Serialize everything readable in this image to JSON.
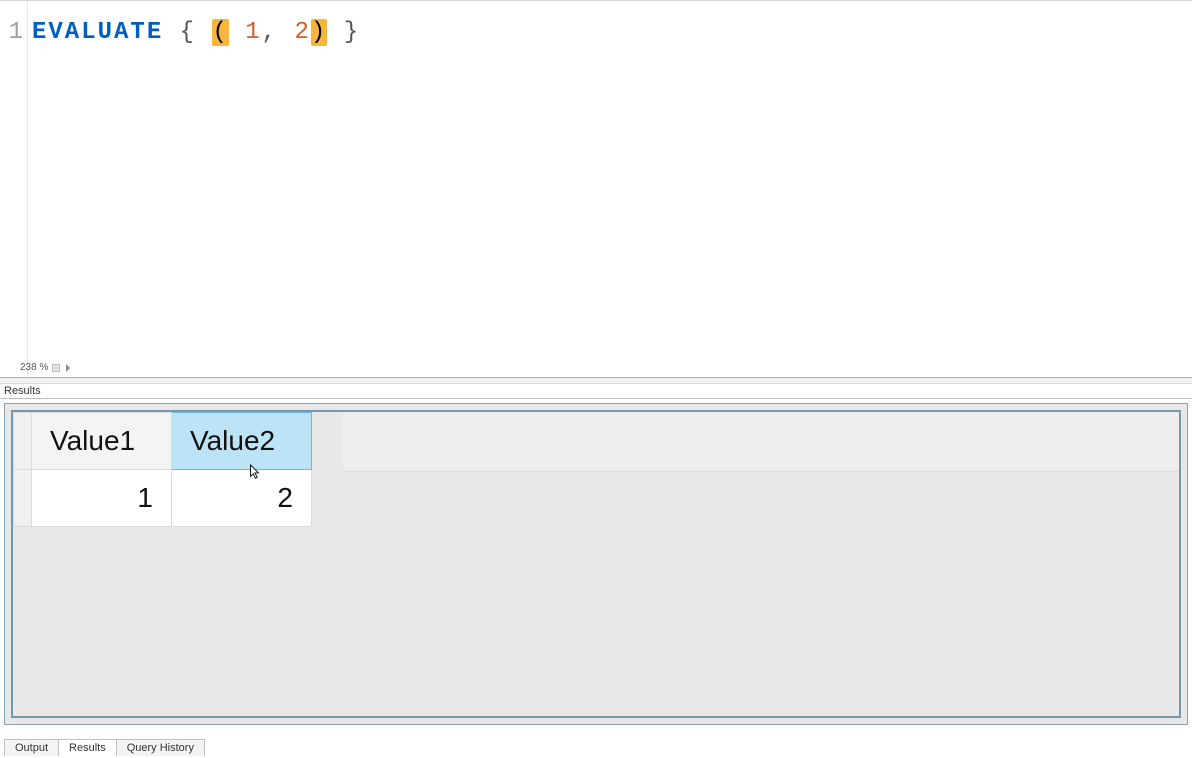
{
  "editor": {
    "line_number": "1",
    "tokens": {
      "keyword": "EVALUATE",
      "open_brace": "{",
      "open_paren": "(",
      "num1": "1",
      "comma": ",",
      "num2": "2",
      "close_paren": ")",
      "close_brace": "}"
    },
    "zoom_text": "238 %"
  },
  "results": {
    "panel_label": "Results",
    "headers": [
      "Value1",
      "Value2"
    ],
    "selected_header_index": 1,
    "rows": [
      [
        "1",
        "2"
      ]
    ]
  },
  "tabs": {
    "output": "Output",
    "results": "Results",
    "query_history": "Query History",
    "active": "results"
  }
}
